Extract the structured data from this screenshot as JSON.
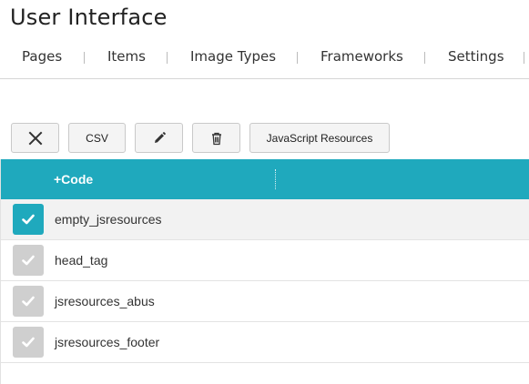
{
  "page": {
    "title": "User Interface"
  },
  "tabs": [
    {
      "label": "Pages"
    },
    {
      "label": "Items"
    },
    {
      "label": "Image Types"
    },
    {
      "label": "Frameworks"
    },
    {
      "label": "Settings"
    }
  ],
  "toolbar": {
    "close_icon": "x-icon",
    "csv_label": "CSV",
    "edit_icon": "pencil-icon",
    "delete_icon": "trash-icon",
    "resource_label": "JavaScript Resources"
  },
  "grid": {
    "header": {
      "code": "+Code"
    },
    "accent_color": "#1fa9bd",
    "rows": [
      {
        "code": "empty_jsresources",
        "checked": true
      },
      {
        "code": "head_tag",
        "checked": false
      },
      {
        "code": "jsresources_abus",
        "checked": false
      },
      {
        "code": "jsresources_footer",
        "checked": false
      }
    ]
  }
}
